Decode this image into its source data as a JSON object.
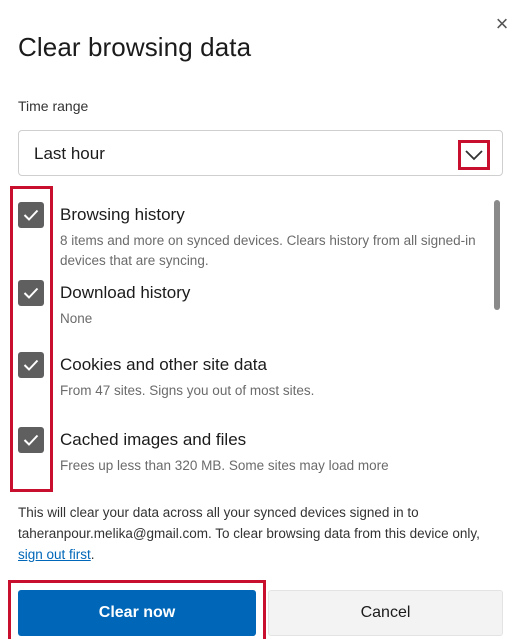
{
  "dialog": {
    "title": "Clear browsing data",
    "close_label": "×"
  },
  "time_range": {
    "label": "Time range",
    "selected": "Last hour"
  },
  "options": [
    {
      "title": "Browsing history",
      "desc": "8 items and more on synced devices. Clears history from all signed-in devices that are syncing.",
      "checked": true
    },
    {
      "title": "Download history",
      "desc": "None",
      "checked": true
    },
    {
      "title": "Cookies and other site data",
      "desc": "From 47 sites. Signs you out of most sites.",
      "checked": true
    },
    {
      "title": "Cached images and files",
      "desc": "Frees up less than 320 MB. Some sites may load more",
      "checked": true
    }
  ],
  "footer": {
    "text": "This will clear your data across all your synced devices signed in to taheranpour.melika@gmail.com. To clear browsing data from this device only, ",
    "link": "sign out first",
    "end": "."
  },
  "buttons": {
    "clear": "Clear now",
    "cancel": "Cancel"
  },
  "colors": {
    "accent": "#0067b8",
    "highlight": "#c8102e",
    "checkbox": "#5f5f5f"
  }
}
